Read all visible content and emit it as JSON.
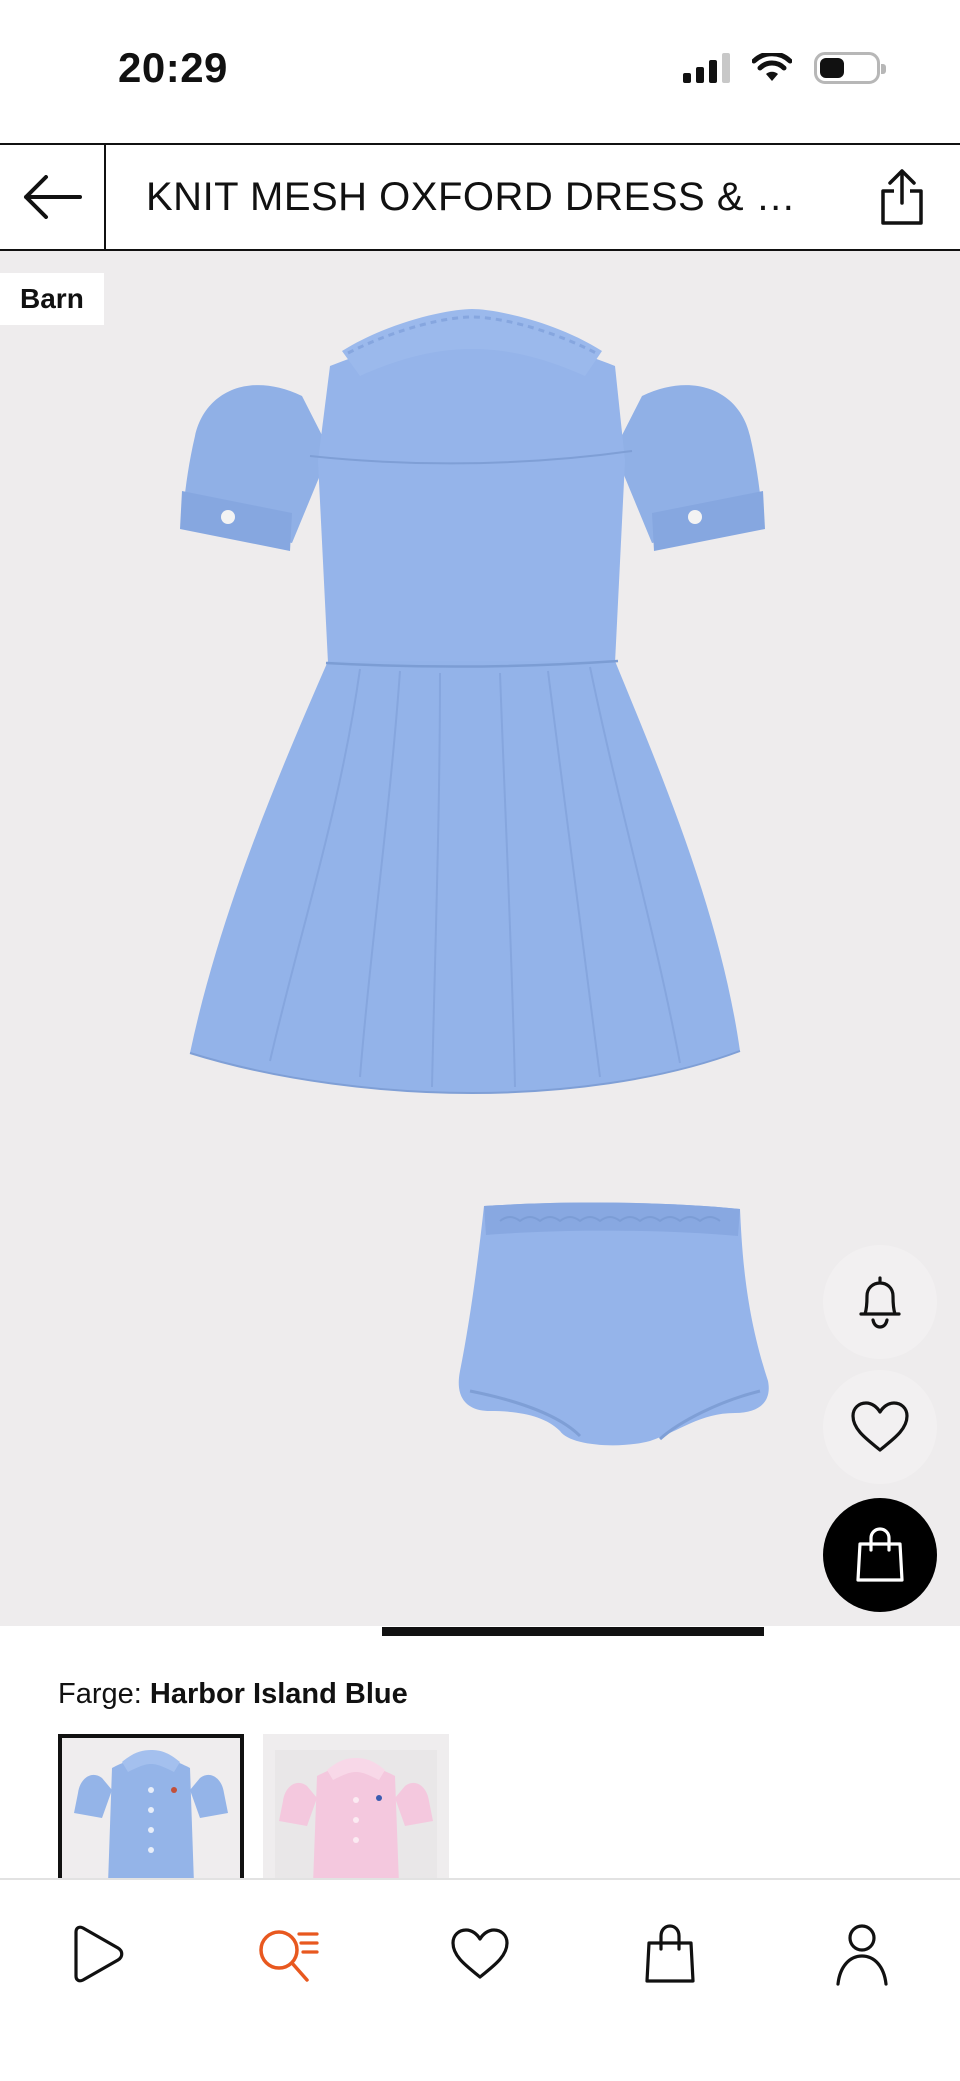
{
  "status_bar": {
    "time": "20:29",
    "icons": [
      "signal-icon",
      "wifi-icon",
      "battery-icon"
    ],
    "battery_level": 0.45
  },
  "header": {
    "back_icon": "arrow-left-icon",
    "title": "KNIT MESH OXFORD DRESS & B...",
    "share_icon": "share-icon"
  },
  "gallery": {
    "badge": "Barn",
    "background_color": "#eeeced",
    "product_color": "#94b4e8"
  },
  "floating_actions": {
    "notify_icon": "bell-icon",
    "favorite_icon": "heart-icon",
    "bag_icon": "shopping-bag-icon"
  },
  "color_selector": {
    "label": "Farge:",
    "selected_value": "Harbor Island Blue",
    "options": [
      {
        "name": "blue-dress-swatch",
        "color": "#94b4e8",
        "selected": true
      },
      {
        "name": "pink-dress-swatch",
        "color": "#f4c8de",
        "selected": false
      }
    ]
  },
  "bottom_nav": {
    "items": [
      {
        "name": "nav-home",
        "icon": "play-icon"
      },
      {
        "name": "nav-search",
        "icon": "search-list-icon",
        "active": true
      },
      {
        "name": "nav-favorites",
        "icon": "heart-icon"
      },
      {
        "name": "nav-bag",
        "icon": "shopping-bag-icon"
      },
      {
        "name": "nav-profile",
        "icon": "user-icon"
      }
    ],
    "accent_color": "#e8581f"
  }
}
